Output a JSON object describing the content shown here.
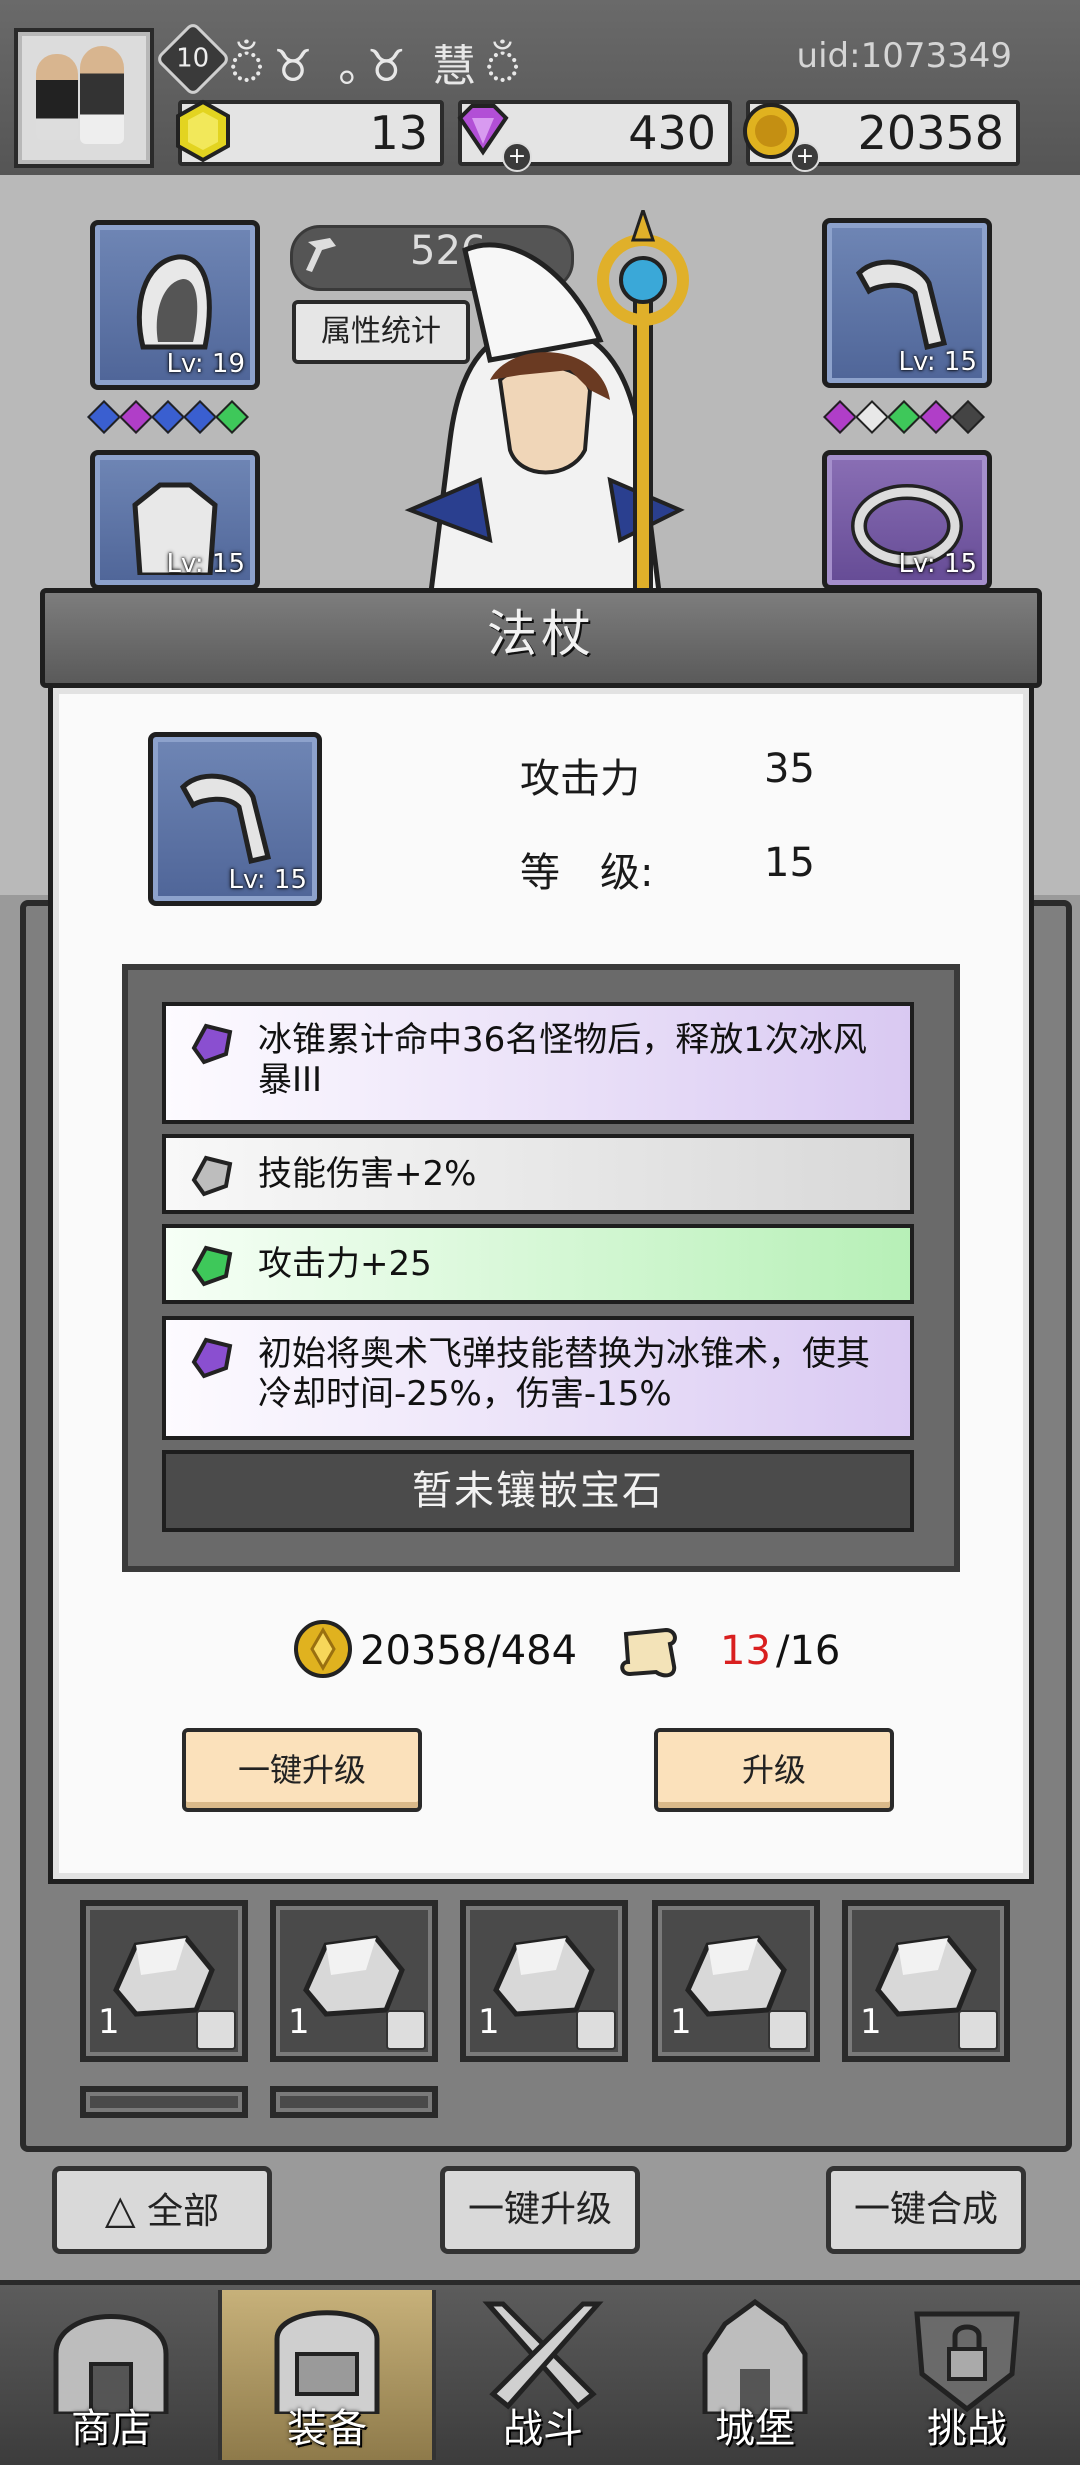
{
  "player": {
    "level": "10",
    "name": "ঁ♉ ｡♉ 慧ঁ",
    "uid": "uid:1073349"
  },
  "resources": [
    {
      "name": "yellow-gem",
      "value": "13",
      "color": "#e3d420"
    },
    {
      "name": "diamond",
      "value": "430",
      "color": "#b24fd6"
    },
    {
      "name": "gold-coin",
      "value": "20358",
      "color": "#e0b21f"
    }
  ],
  "equipment": {
    "power": "526",
    "stats_button": "属性统计",
    "slots": [
      {
        "id": "hood",
        "level": "Lv: 19"
      },
      {
        "id": "cloak",
        "level": "Lv: 15"
      },
      {
        "id": "staff",
        "level": "Lv: 15"
      },
      {
        "id": "ring",
        "level": "Lv: 15"
      }
    ]
  },
  "modal": {
    "title": "法杖",
    "item_level_badge": "Lv: 15",
    "attack_label": "攻击力",
    "attack_value": "35",
    "level_label": "等　级:",
    "level_value": "15",
    "effects": [
      {
        "text": "冰锥累计命中36名怪物后，释放1次冰风暴III",
        "rarity": "purple"
      },
      {
        "text": "技能伤害+2%",
        "rarity": "gray"
      },
      {
        "text": "攻击力+25",
        "rarity": "green"
      },
      {
        "text": "初始将奥术飞弹技能替换为冰锥术，使其冷却时间-25%，伤害-15%",
        "rarity": "purple"
      }
    ],
    "no_gem_text": "暂未镶嵌宝石",
    "cost_coins": "20358/484",
    "scroll_have": "13",
    "scroll_need": "/16",
    "auto_upgrade_label": "一键升级",
    "upgrade_label": "升级"
  },
  "inventory": {
    "items": [
      {
        "count": "1"
      },
      {
        "count": "1"
      },
      {
        "count": "1"
      },
      {
        "count": "1"
      },
      {
        "count": "1"
      }
    ]
  },
  "bottom_buttons": {
    "filter_all": "全部",
    "auto_upgrade": "一键升级",
    "auto_merge": "一键合成"
  },
  "nav": [
    {
      "id": "shop",
      "label": "商店"
    },
    {
      "id": "equip",
      "label": "装备"
    },
    {
      "id": "battle",
      "label": "战斗"
    },
    {
      "id": "castle",
      "label": "城堡"
    },
    {
      "id": "challenge",
      "label": "挑战"
    }
  ]
}
